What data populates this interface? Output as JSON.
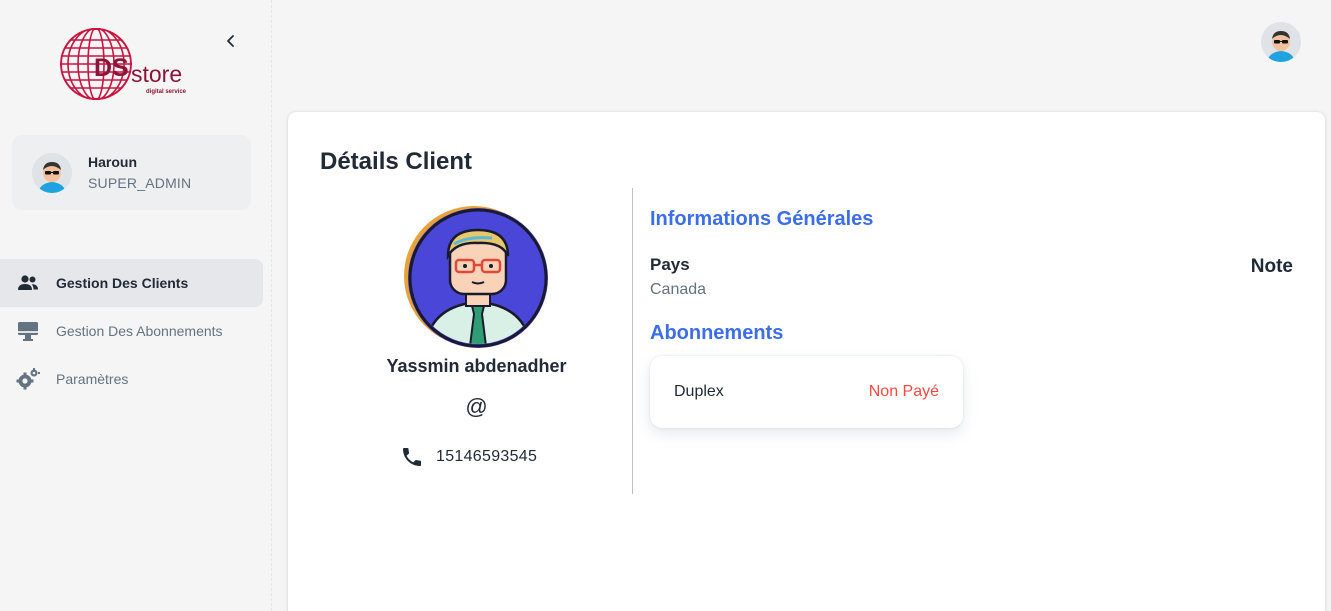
{
  "brand": {
    "logo_text_ds": "DS",
    "logo_text_store": "store",
    "logo_tagline": "digital service",
    "colors": {
      "primary": "#8b1538"
    }
  },
  "sidebar": {
    "user": {
      "name": "Haroun",
      "role": "SUPER_ADMIN"
    },
    "items": [
      {
        "label": "Gestion Des Clients",
        "icon": "people-icon",
        "active": true
      },
      {
        "label": "Gestion Des Abonnements",
        "icon": "monitor-icon",
        "active": false
      },
      {
        "label": "Paramètres",
        "icon": "settings-gear-icon",
        "active": false
      }
    ]
  },
  "page": {
    "title": "Détails Client",
    "client": {
      "name": "Yassmin abdenadher",
      "email_symbol": "@",
      "phone": "15146593545"
    },
    "general": {
      "title": "Informations Générales",
      "pays_label": "Pays",
      "pays_value": "Canada",
      "note_label": "Note"
    },
    "subscriptions": {
      "title": "Abonnements",
      "items": [
        {
          "name": "Duplex",
          "status": "Non Payé",
          "status_color": "#ff4842"
        }
      ]
    }
  },
  "colors": {
    "accent_blue": "#3b6ee8",
    "error_red": "#ff4842",
    "text_primary": "#212b36",
    "text_secondary": "#637381"
  }
}
